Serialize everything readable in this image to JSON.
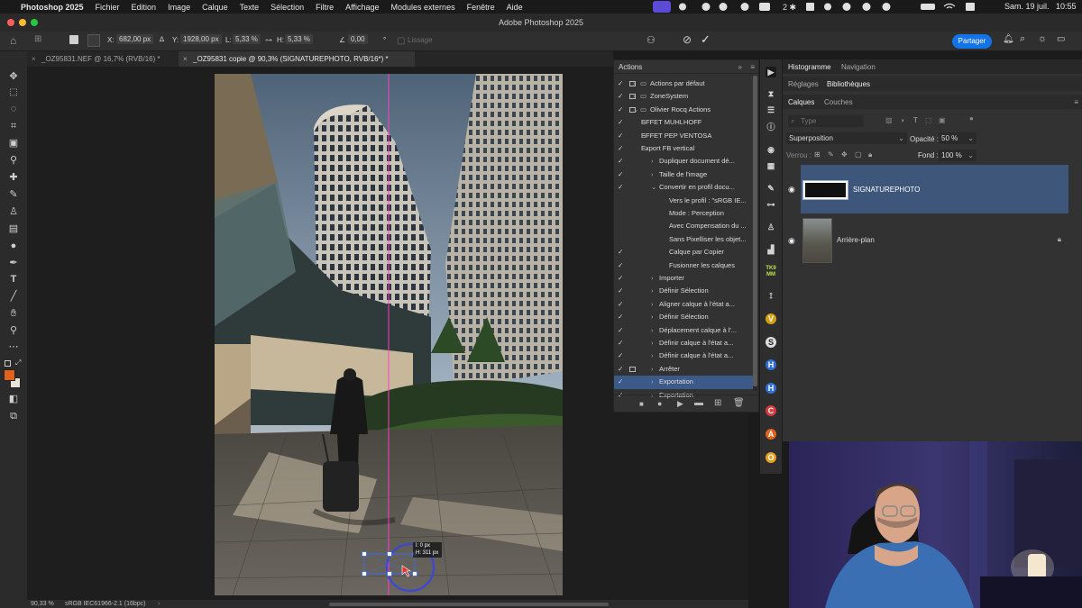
{
  "menubar": {
    "items": [
      "Photoshop 2025",
      "Fichier",
      "Edition",
      "Image",
      "Calque",
      "Texte",
      "Sélection",
      "Filtre",
      "Affichage",
      "Modules externes",
      "Fenêtre",
      "Aide"
    ],
    "clock": "Sam. 19 juil.   10:55"
  },
  "window": {
    "title": "Adobe Photoshop 2025"
  },
  "options": {
    "x_label": "X:",
    "x_value": "682,00 px",
    "y_label": "Y:",
    "y_value": "1928,00 px",
    "w_label": "L:",
    "w_value": "5,33 %",
    "h_label": "H:",
    "h_value": "5,33 %",
    "angle_value": "0,00",
    "angle_unit": "°",
    "smoothing": "Lissage",
    "share": "Partager"
  },
  "tabs": [
    {
      "label": "_OZ95831.NEF @ 16,7% (RVB/16) *"
    },
    {
      "label": "_OZ95831 copie @ 90,3% (SIGNATUREPHOTO, RVB/16*) *"
    }
  ],
  "canvas": {
    "tooltip_w": "l: 0 px",
    "tooltip_h": "H: 311 px"
  },
  "status": {
    "zoom": "90,33 %",
    "profile": "sRGB IEC61966-2.1 (16bpc)"
  },
  "actions_panel": {
    "title": "Actions",
    "rows": [
      {
        "label": "Actions par défaut",
        "check": "✓",
        "indent": 0,
        "kind": "set"
      },
      {
        "label": "ZoneSystem",
        "check": "✓",
        "indent": 0,
        "kind": "set"
      },
      {
        "label": "Olivier Rocq Actions",
        "check": "✓",
        "indent": 0,
        "kind": "set-open"
      },
      {
        "label": "EFFET MUHLHOFF",
        "check": "✓",
        "indent": 1,
        "kind": "action"
      },
      {
        "label": "EFFET PEP VENTOSA",
        "check": "✓",
        "indent": 1,
        "kind": "action"
      },
      {
        "label": "Export FB vertical",
        "check": "✓",
        "indent": 1,
        "kind": "action-open"
      },
      {
        "label": "Dupliquer document dé...",
        "check": "✓",
        "indent": 2,
        "kind": "step"
      },
      {
        "label": "Taille de l'image",
        "check": "✓",
        "indent": 2,
        "kind": "step"
      },
      {
        "label": "Convertir en profil docu...",
        "check": "✓",
        "indent": 2,
        "kind": "step-open"
      },
      {
        "label": "Vers le profil :  \"sRGB IE...",
        "check": "",
        "indent": 3,
        "kind": "param"
      },
      {
        "label": "Mode : Perception",
        "check": "",
        "indent": 3,
        "kind": "param"
      },
      {
        "label": "Avec Compensation du ...",
        "check": "",
        "indent": 3,
        "kind": "param"
      },
      {
        "label": "Sans Pixelliser les objet...",
        "check": "",
        "indent": 3,
        "kind": "param"
      },
      {
        "label": "Calque par Copier",
        "check": "✓",
        "indent": 3,
        "kind": "param"
      },
      {
        "label": "Fusionner les calques",
        "check": "✓",
        "indent": 3,
        "kind": "param"
      },
      {
        "label": "Importer",
        "check": "✓",
        "indent": 2,
        "kind": "step"
      },
      {
        "label": "Définir Sélection",
        "check": "✓",
        "indent": 2,
        "kind": "step"
      },
      {
        "label": "Aligner calque à l'état a...",
        "check": "✓",
        "indent": 2,
        "kind": "step"
      },
      {
        "label": "Définir Sélection",
        "check": "✓",
        "indent": 2,
        "kind": "step"
      },
      {
        "label": "Déplacement calque à l'...",
        "check": "✓",
        "indent": 2,
        "kind": "step"
      },
      {
        "label": "Définir calque à l'état a...",
        "check": "✓",
        "indent": 2,
        "kind": "step"
      },
      {
        "label": "Définir calque à l'état a...",
        "check": "✓",
        "indent": 2,
        "kind": "step"
      },
      {
        "label": "Arrêter",
        "check": "✓",
        "indent": 2,
        "kind": "step-dialog"
      },
      {
        "label": "Exportation",
        "check": "✓",
        "indent": 2,
        "kind": "step-selected"
      },
      {
        "label": "Exportation",
        "check": "✓",
        "indent": 2,
        "kind": "step"
      }
    ]
  },
  "right_panel": {
    "top_tabs": [
      "Histogramme",
      "Navigation"
    ],
    "mid_tabs": [
      "Réglages",
      "Bibliothèques"
    ],
    "layer_tabs": [
      "Calques",
      "Couches"
    ],
    "filter_placeholder": "Type",
    "blend_mode": "Superposition",
    "opacity_label": "Opacité :",
    "opacity_value": "50 %",
    "lock_label": "Verrou :",
    "fill_label": "Fond :",
    "fill_value": "100 %",
    "layers": [
      {
        "name": "SIGNATUREPHOTO",
        "selected": true
      },
      {
        "name": "Arrière-plan",
        "selected": false
      }
    ]
  },
  "side_icons": [
    "TK9 MM"
  ],
  "colors": {
    "accent": "#1473e6",
    "selection": "#3b5a87",
    "foreground_swatch": "#e0621d",
    "guide": "#ff3cc8"
  }
}
